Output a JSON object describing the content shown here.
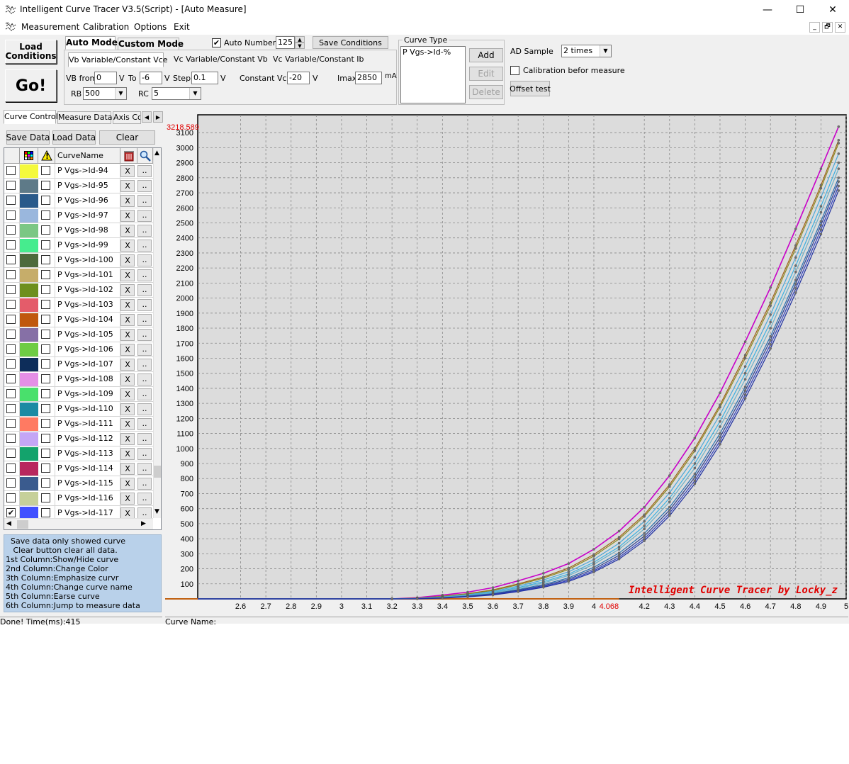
{
  "window": {
    "title": "Intelligent Curve Tracer V3.5(Script) - [Auto Measure]",
    "minimize": "—",
    "maximize": "☐",
    "close": "✕"
  },
  "menu": [
    "Measurement",
    "Calibration",
    "Options",
    "Exit"
  ],
  "mdi_buttons": [
    "_",
    "🗗",
    "✕"
  ],
  "toolbar": {
    "load_conditions": "Load Conditions",
    "go": "Go!",
    "mode_tabs": [
      "Auto Mode",
      "Custom Mode"
    ],
    "auto_number_label": "Auto Number",
    "auto_number_checked": true,
    "auto_number_value": "125",
    "save_conditions": "Save Conditions",
    "sub_tabs": [
      "Vb Variable/Constant Vce",
      "Vc Variable/Constant Vb",
      "Vc Variable/Constant Ib"
    ],
    "vb_from_label": "VB from",
    "vb_from": "0",
    "v1": "V",
    "to_label": "To",
    "vb_to": "-6",
    "v2": "V",
    "step_label": "Step",
    "step": "0.1",
    "v3": "V",
    "const_vce_label": "Constant Vce",
    "const_vce": "-20",
    "v4": "V",
    "imax_label": "Imax",
    "imax": "2850",
    "ma": "mA",
    "rb_label": "RB",
    "rb": "500",
    "rc_label": "RC",
    "rc": "5"
  },
  "curve_type": {
    "title": "Curve Type",
    "items": [
      "P Vgs->Id-%"
    ],
    "add": "Add",
    "edit": "Edit",
    "delete": "Delete"
  },
  "ad": {
    "label": "AD Sample",
    "value": "2 times",
    "calibration_label": "Calibration befor measure",
    "calibration_checked": false,
    "offset_test": "Offset test"
  },
  "left_tabs": [
    "Curve Control",
    "Measure Data",
    "Axis Co"
  ],
  "left_buttons": {
    "save": "Save Data",
    "load": "Load Data",
    "clear": "Clear"
  },
  "grid": {
    "header": {
      "name": "CurveName",
      "warn": "!"
    },
    "x_label": "X",
    "dots_label": "..",
    "rows": [
      {
        "name": "P Vgs->Id-94",
        "color": "#f4f93c",
        "checked": false
      },
      {
        "name": "P Vgs->Id-95",
        "color": "#5e7a88",
        "checked": false
      },
      {
        "name": "P Vgs->Id-96",
        "color": "#2a5a8a",
        "checked": false
      },
      {
        "name": "P Vgs->Id-97",
        "color": "#9ab7dd",
        "checked": false
      },
      {
        "name": "P Vgs->Id-98",
        "color": "#7bc784",
        "checked": false
      },
      {
        "name": "P Vgs->Id-99",
        "color": "#46ec8e",
        "checked": false
      },
      {
        "name": "P Vgs->Id-100",
        "color": "#4d6a3c",
        "checked": false
      },
      {
        "name": "P Vgs->Id-101",
        "color": "#c6ad6a",
        "checked": false
      },
      {
        "name": "P Vgs->Id-102",
        "color": "#6d8f1d",
        "checked": false
      },
      {
        "name": "P Vgs->Id-103",
        "color": "#e45c6a",
        "checked": false
      },
      {
        "name": "P Vgs->Id-104",
        "color": "#c0580e",
        "checked": false
      },
      {
        "name": "P Vgs->Id-105",
        "color": "#8670a6",
        "checked": false
      },
      {
        "name": "P Vgs->Id-106",
        "color": "#6ecc44",
        "checked": false
      },
      {
        "name": "P Vgs->Id-107",
        "color": "#0d2d5a",
        "checked": false
      },
      {
        "name": "P Vgs->Id-108",
        "color": "#e48fe6",
        "checked": false
      },
      {
        "name": "P Vgs->Id-109",
        "color": "#49e06c",
        "checked": false
      },
      {
        "name": "P Vgs->Id-110",
        "color": "#1b8aa3",
        "checked": false
      },
      {
        "name": "P Vgs->Id-111",
        "color": "#ff7a62",
        "checked": false
      },
      {
        "name": "P Vgs->Id-112",
        "color": "#c4a6f6",
        "checked": false
      },
      {
        "name": "P Vgs->Id-113",
        "color": "#13a36c",
        "checked": false
      },
      {
        "name": "P Vgs->Id-114",
        "color": "#b8275e",
        "checked": false
      },
      {
        "name": "P Vgs->Id-115",
        "color": "#3a5b8e",
        "checked": false
      },
      {
        "name": "P Vgs->Id-116",
        "color": "#c6d09a",
        "checked": false
      },
      {
        "name": "P Vgs->Id-117",
        "color": "#4050ff",
        "checked": true
      }
    ]
  },
  "help_lines": [
    "  Save data only showed curve",
    "   Clear button clear all data.",
    "1st Column:Show/Hide curve",
    "2nd Column:Change Color",
    "3th Column:Emphasize curvr",
    "4th Column:Change curve name",
    "5th Column:Earse curve",
    "6th Column:Jump to measure data"
  ],
  "status": {
    "left": "Done!  Time(ms):415",
    "right": "Curve Name:"
  },
  "chart_data": {
    "type": "line",
    "xlim": [
      2.43,
      5.0
    ],
    "ylim": [
      0,
      3218.589
    ],
    "x_ticks": [
      2.6,
      2.7,
      2.8,
      2.9,
      3,
      3.1,
      3.2,
      3.3,
      3.4,
      3.5,
      3.6,
      3.7,
      3.8,
      3.9,
      4,
      4.2,
      4.3,
      4.4,
      4.5,
      4.6,
      4.7,
      4.8,
      4.9,
      5
    ],
    "y_ticks": [
      100,
      200,
      300,
      400,
      500,
      600,
      700,
      800,
      900,
      1000,
      1100,
      1200,
      1300,
      1400,
      1500,
      1600,
      1700,
      1800,
      1900,
      2000,
      2100,
      2200,
      2300,
      2400,
      2500,
      2600,
      2700,
      2800,
      2900,
      3000,
      3100
    ],
    "y_max_label": "3218.589",
    "cursor_x_label": "4.068",
    "watermark": "Intelligent Curve Tracer by Locky_z",
    "grid": true,
    "series_colors": [
      "#c800c8",
      "#a0601a",
      "#8a8a20",
      "#4aa8d8",
      "#3bb0e0",
      "#6ab0c8",
      "#2a70b0",
      "#304090",
      "#3040c0",
      "#2030a0"
    ],
    "series": [
      {
        "x": [
          2.43,
          3.2,
          3.3,
          3.4,
          3.5,
          3.6,
          3.7,
          3.8,
          3.9,
          4.0,
          4.1,
          4.2,
          4.3,
          4.4,
          4.5,
          4.6,
          4.7,
          4.8,
          4.9,
          4.97
        ],
        "values": [
          0,
          0,
          8,
          25,
          45,
          75,
          120,
          170,
          235,
          330,
          450,
          610,
          820,
          1070,
          1370,
          1710,
          2070,
          2460,
          2860,
          3140
        ]
      },
      {
        "x": [
          2.43,
          3.2,
          3.3,
          3.4,
          3.5,
          3.6,
          3.7,
          3.8,
          3.9,
          4.0,
          4.1,
          4.2,
          4.3,
          4.4,
          4.5,
          4.6,
          4.7,
          4.8,
          4.9,
          4.97
        ],
        "values": [
          0,
          0,
          5,
          18,
          35,
          60,
          100,
          145,
          205,
          295,
          410,
          560,
          760,
          1000,
          1290,
          1620,
          1970,
          2350,
          2750,
          3050
        ]
      },
      {
        "x": [
          2.43,
          3.2,
          3.3,
          3.4,
          3.5,
          3.6,
          3.7,
          3.8,
          3.9,
          4.0,
          4.1,
          4.2,
          4.3,
          4.4,
          4.5,
          4.6,
          4.7,
          4.8,
          4.9,
          4.97
        ],
        "values": [
          0,
          0,
          4,
          16,
          32,
          56,
          94,
          138,
          196,
          284,
          398,
          548,
          746,
          985,
          1275,
          1600,
          1950,
          2330,
          2730,
          3030
        ]
      },
      {
        "x": [
          2.43,
          3.2,
          3.3,
          3.4,
          3.5,
          3.6,
          3.7,
          3.8,
          3.9,
          4.0,
          4.1,
          4.2,
          4.3,
          4.4,
          4.5,
          4.6,
          4.7,
          4.8,
          4.9,
          4.97
        ],
        "values": [
          0,
          0,
          3,
          13,
          28,
          50,
          85,
          126,
          180,
          262,
          370,
          515,
          705,
          940,
          1225,
          1545,
          1890,
          2270,
          2670,
          2960
        ]
      },
      {
        "x": [
          2.43,
          3.2,
          3.3,
          3.4,
          3.5,
          3.6,
          3.7,
          3.8,
          3.9,
          4.0,
          4.1,
          4.2,
          4.3,
          4.4,
          4.5,
          4.6,
          4.7,
          4.8,
          4.9,
          4.97
        ],
        "values": [
          0,
          0,
          2,
          11,
          24,
          44,
          76,
          114,
          165,
          243,
          346,
          485,
          670,
          900,
          1180,
          1500,
          1840,
          2215,
          2610,
          2900
        ]
      },
      {
        "x": [
          2.43,
          3.2,
          3.3,
          3.4,
          3.5,
          3.6,
          3.7,
          3.8,
          3.9,
          4.0,
          4.1,
          4.2,
          4.3,
          4.4,
          4.5,
          4.6,
          4.7,
          4.8,
          4.9,
          4.97
        ],
        "values": [
          0,
          0,
          2,
          10,
          22,
          40,
          70,
          106,
          155,
          230,
          330,
          465,
          645,
          870,
          1145,
          1460,
          1800,
          2175,
          2570,
          2860
        ]
      },
      {
        "x": [
          2.43,
          3.2,
          3.3,
          3.4,
          3.5,
          3.6,
          3.7,
          3.8,
          3.9,
          4.0,
          4.1,
          4.2,
          4.3,
          4.4,
          4.5,
          4.6,
          4.7,
          4.8,
          4.9,
          4.97
        ],
        "values": [
          0,
          0,
          1,
          8,
          19,
          35,
          62,
          95,
          140,
          210,
          305,
          435,
          610,
          830,
          1100,
          1410,
          1745,
          2120,
          2510,
          2800
        ]
      },
      {
        "x": [
          2.43,
          3.2,
          3.3,
          3.4,
          3.5,
          3.6,
          3.7,
          3.8,
          3.9,
          4.0,
          4.1,
          4.2,
          4.3,
          4.4,
          4.5,
          4.6,
          4.7,
          4.8,
          4.9,
          4.97
        ],
        "values": [
          0,
          0,
          1,
          7,
          17,
          32,
          57,
          88,
          131,
          198,
          290,
          417,
          590,
          808,
          1075,
          1385,
          1720,
          2095,
          2485,
          2775
        ]
      },
      {
        "x": [
          2.43,
          3.2,
          3.3,
          3.4,
          3.5,
          3.6,
          3.7,
          3.8,
          3.9,
          4.0,
          4.1,
          4.2,
          4.3,
          4.4,
          4.5,
          4.6,
          4.7,
          4.8,
          4.9,
          4.97
        ],
        "values": [
          0,
          0,
          1,
          6,
          15,
          29,
          52,
          82,
          123,
          187,
          276,
          400,
          570,
          786,
          1050,
          1358,
          1692,
          2065,
          2455,
          2745
        ]
      },
      {
        "x": [
          2.43,
          3.2,
          3.3,
          3.4,
          3.5,
          3.6,
          3.7,
          3.8,
          3.9,
          4.0,
          4.1,
          4.2,
          4.3,
          4.4,
          4.5,
          4.6,
          4.7,
          4.8,
          4.9,
          4.97
        ],
        "values": [
          0,
          0,
          0,
          5,
          13,
          26,
          48,
          77,
          116,
          178,
          265,
          386,
          553,
          766,
          1028,
          1333,
          1665,
          2036,
          2425,
          2715
        ]
      }
    ]
  }
}
